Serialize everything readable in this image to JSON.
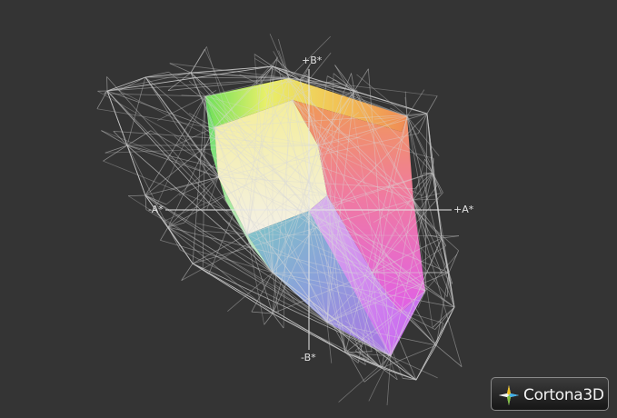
{
  "viewer": {
    "axes": {
      "b_plus": "+B*",
      "b_minus": "-B*",
      "a_plus": "+A*",
      "a_minus": "-A*"
    },
    "brand": "Cortona3D",
    "colors": {
      "background": "#343434",
      "wireframe": "#d8d8d8"
    }
  }
}
